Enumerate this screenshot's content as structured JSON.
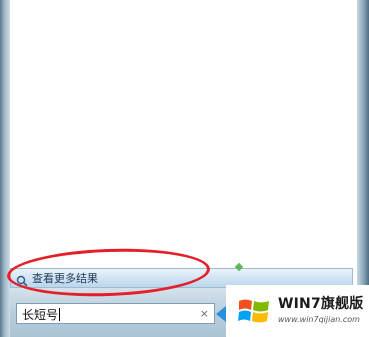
{
  "start_menu": {
    "more_results_label": "查看更多结果",
    "search": {
      "value": "长短号",
      "clear_symbol": "×"
    }
  },
  "watermark": {
    "title": "WIN7旗舰版",
    "url": "www.win7qijian.com"
  },
  "icons": {
    "search": "search-icon",
    "clear": "clear-icon",
    "logo": "windows-logo-icon"
  },
  "colors": {
    "annotation": "#e41f2a",
    "accent": "#2a8fd6"
  }
}
